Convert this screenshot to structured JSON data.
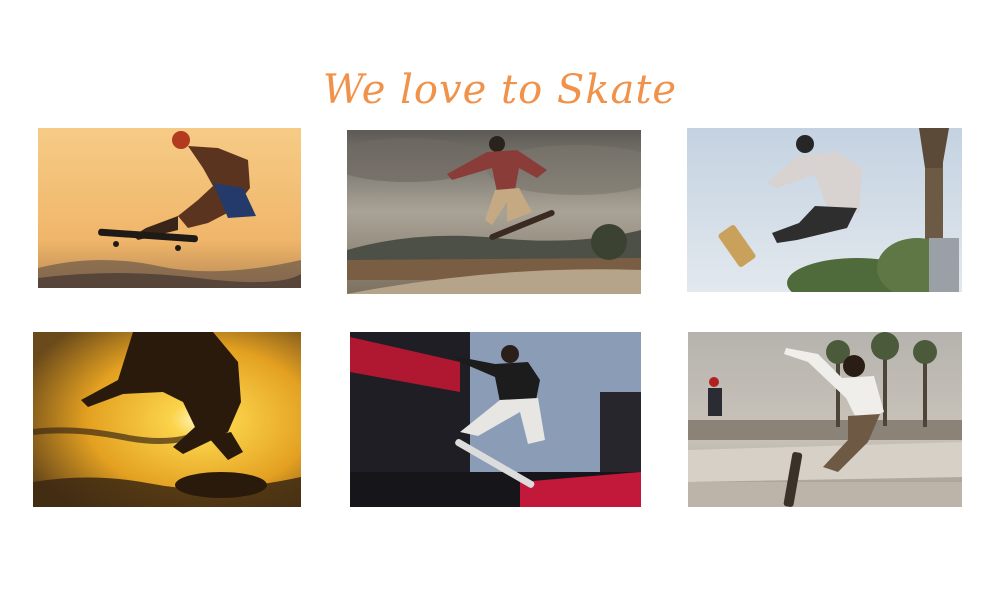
{
  "header": {
    "title": "We love to Skate"
  },
  "gallery": {
    "photos": [
      {
        "subject": "skater silhouette at sunset",
        "palette": [
          "#f3c27a",
          "#c98b3e"
        ]
      },
      {
        "subject": "skater over ramp under cloudy sky",
        "palette": [
          "#8f8a7e",
          "#5c4a38"
        ]
      },
      {
        "subject": "skater mid-air with palm tree",
        "palette": [
          "#c9d6e4",
          "#3f3f3f"
        ]
      },
      {
        "subject": "skater silhouette against sun",
        "palette": [
          "#f4b935",
          "#3b2410"
        ]
      },
      {
        "subject": "skater at event arena",
        "palette": [
          "#2c2c36",
          "#c2183a"
        ]
      },
      {
        "subject": "skater on street park with palms",
        "palette": [
          "#bdb6ad",
          "#3a3530"
        ]
      }
    ]
  }
}
